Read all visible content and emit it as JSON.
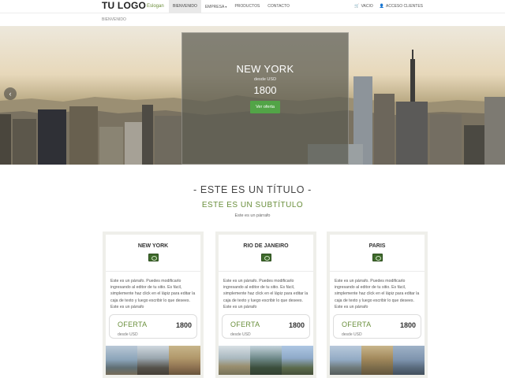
{
  "nav": {
    "logo": "TU LOGO",
    "slogan": "Eslogan",
    "items": [
      {
        "label": "BIENVENIDO"
      },
      {
        "label": "EMPRESA"
      },
      {
        "label": "PRODUCTOS"
      },
      {
        "label": "CONTACTO"
      }
    ],
    "cart": "VACIO",
    "login": "ACCESO CLIENTES"
  },
  "breadcrumb": "BIENVENIDO",
  "hero": {
    "city": "NEW YORK",
    "from": "desde USD",
    "price": "1800",
    "button": "Ver oferta"
  },
  "section": {
    "title": "- ESTE ES UN TÍTULO -",
    "subtitle": "ESTE ES UN SUBTÍTULO",
    "paragraph": "Este es un párrafo"
  },
  "cards": [
    {
      "city": "NEW YORK",
      "text": "Este es un párrafo. Puedes modificarlo ingresando al editor de tu sitio. Es fácil, simplemente haz click en el lápiz para editar la caja de texto y luego escribir lo que desees. Este es un párrafo",
      "offer": "OFERTA",
      "price": "1800",
      "from": "desde USD"
    },
    {
      "city": "RIO DE JANEIRO",
      "text": "Este es un párrafo. Puedes modificarlo ingresando al editor de tu sitio. Es fácil, simplemente haz click en el lápiz para editar la caja de texto y luego escribir lo que desees. Este es un párrafo",
      "offer": "OFERTA",
      "price": "1800",
      "from": "desde USD"
    },
    {
      "city": "PARIS",
      "text": "Este es un párrafo. Puedes modificarlo ingresando al editor de tu sitio. Es fácil, simplemente haz click en el lápiz para editar la caja de texto y luego escribir lo que desees. Este es un párrafo",
      "offer": "OFERTA",
      "price": "1800",
      "from": "desde USD"
    }
  ],
  "colors": {
    "accent_green": "#52a447",
    "subtitle_green": "#6a8f3c"
  }
}
